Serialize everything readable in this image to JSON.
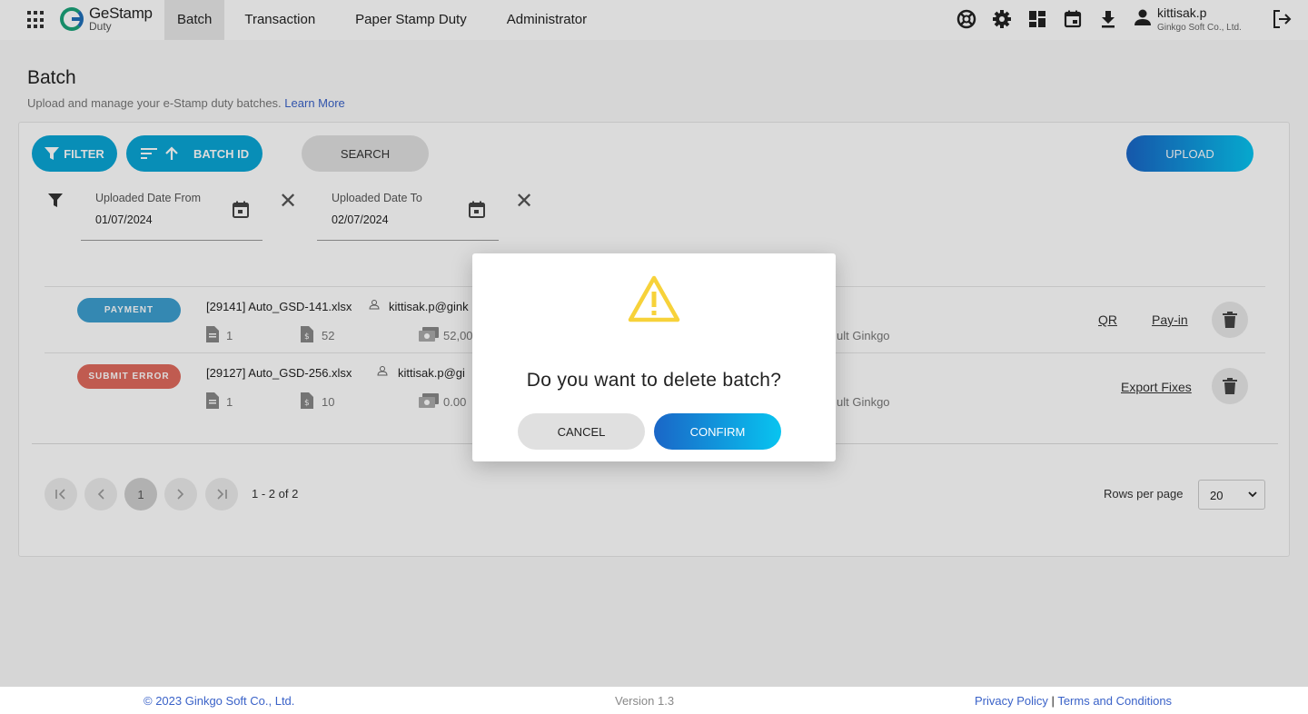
{
  "app": {
    "logo_title": "GeStamp",
    "logo_sub": "Duty"
  },
  "nav": {
    "items": [
      {
        "label": "Batch"
      },
      {
        "label": "Transaction"
      },
      {
        "label": "Paper Stamp Duty"
      },
      {
        "label": "Administrator"
      }
    ]
  },
  "user": {
    "name": "kittisak.p",
    "org": "Ginkgo Soft Co., Ltd."
  },
  "page": {
    "title": "Batch",
    "subtitle": "Upload and manage your e-Stamp duty batches.",
    "learn_more": "Learn More"
  },
  "toolbar": {
    "filter_label": "FILTER",
    "sort_label": "BATCH ID",
    "search_label": "SEARCH",
    "upload_label": "UPLOAD"
  },
  "filters": {
    "from": {
      "label": "Uploaded Date From",
      "value": "01/07/2024"
    },
    "to": {
      "label": "Uploaded Date To",
      "value": "02/07/2024"
    }
  },
  "rows": [
    {
      "status": "PAYMENT",
      "status_color": "#3d9fd0",
      "file": "[29141] Auto_GSD-141.xlsx",
      "user": "kittisak.p@gink",
      "docs": "1",
      "stamps": "52",
      "amount": "52,00",
      "company": "ult Ginkgo",
      "links": [
        "QR",
        "Pay-in"
      ]
    },
    {
      "status": "SUBMIT ERROR",
      "status_color": "#e06a5e",
      "file": "[29127] Auto_GSD-256.xlsx",
      "user": "kittisak.p@gi",
      "docs": "1",
      "stamps": "10",
      "amount": "0.00",
      "company": "ult Ginkgo",
      "links": [
        "Export Fixes"
      ]
    }
  ],
  "pagination": {
    "current": "1",
    "range": "1 - 2 of 2",
    "rows_label": "Rows per page",
    "rows_value": "20"
  },
  "modal": {
    "message": "Do you want to delete batch?",
    "cancel_label": "CANCEL",
    "confirm_label": "CONFIRM"
  },
  "footer": {
    "copyright": "© 2023 Ginkgo Soft Co., Ltd.",
    "version": "Version 1.3",
    "privacy": "Privacy Policy",
    "separator": "|",
    "terms": "Terms and Conditions"
  },
  "colors": {
    "accent": "#0aa6d6",
    "link": "#3a62c8",
    "warning": "#f7d23a"
  }
}
